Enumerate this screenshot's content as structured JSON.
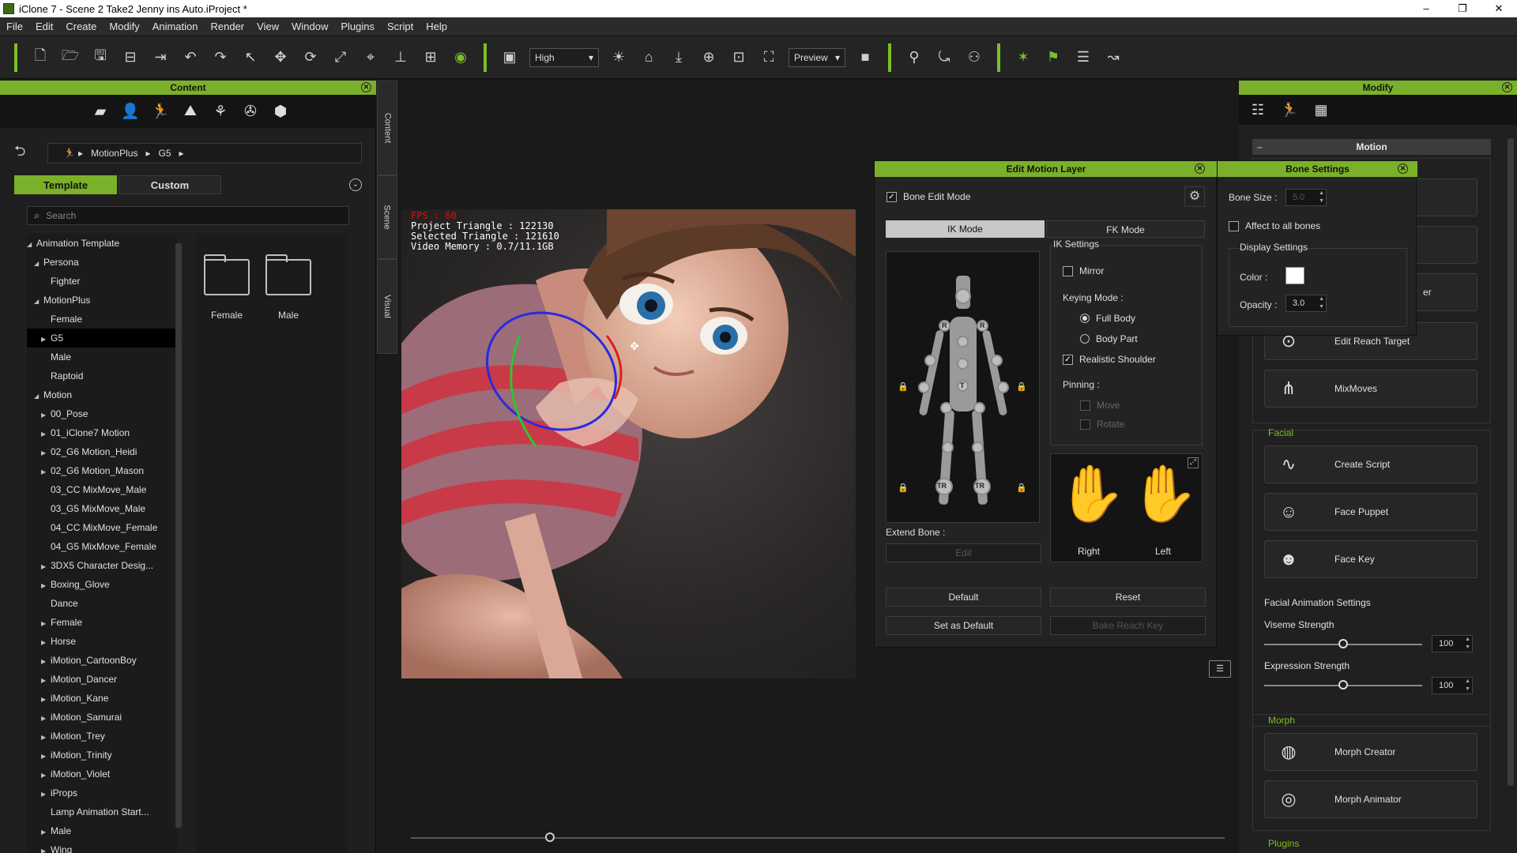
{
  "window": {
    "title": "iClone 7 - Scene 2 Take2 Jenny ins Auto.iProject *"
  },
  "menu": [
    "File",
    "Edit",
    "Create",
    "Modify",
    "Animation",
    "Render",
    "View",
    "Window",
    "Plugins",
    "Script",
    "Help"
  ],
  "toolbar": {
    "quality": "High",
    "preview": "Preview"
  },
  "content": {
    "title": "Content",
    "breadcrumb": [
      "MotionPlus",
      "G5"
    ],
    "tabs": [
      "Template",
      "Custom"
    ],
    "search_placeholder": "Search",
    "tree": [
      {
        "label": "Animation Template",
        "depth": 0,
        "exp": "open"
      },
      {
        "label": "Persona",
        "depth": 1,
        "exp": "open"
      },
      {
        "label": "Fighter",
        "depth": 2,
        "exp": ""
      },
      {
        "label": "MotionPlus",
        "depth": 1,
        "exp": "open"
      },
      {
        "label": "Female",
        "depth": 2,
        "exp": ""
      },
      {
        "label": "G5",
        "depth": 2,
        "exp": "closed",
        "selected": true
      },
      {
        "label": "Male",
        "depth": 2,
        "exp": ""
      },
      {
        "label": "Raptoid",
        "depth": 2,
        "exp": ""
      },
      {
        "label": "Motion",
        "depth": 1,
        "exp": "open"
      },
      {
        "label": "00_Pose",
        "depth": 2,
        "exp": "closed"
      },
      {
        "label": "01_iClone7 Motion",
        "depth": 2,
        "exp": "closed"
      },
      {
        "label": "02_G6 Motion_Heidi",
        "depth": 2,
        "exp": "closed"
      },
      {
        "label": "02_G6 Motion_Mason",
        "depth": 2,
        "exp": "closed"
      },
      {
        "label": "03_CC MixMove_Male",
        "depth": 2,
        "exp": ""
      },
      {
        "label": "03_G5 MixMove_Male",
        "depth": 2,
        "exp": ""
      },
      {
        "label": "04_CC MixMove_Female",
        "depth": 2,
        "exp": ""
      },
      {
        "label": "04_G5 MixMove_Female",
        "depth": 2,
        "exp": ""
      },
      {
        "label": "3DX5 Character Desig...",
        "depth": 2,
        "exp": "closed"
      },
      {
        "label": "Boxing_Glove",
        "depth": 2,
        "exp": "closed"
      },
      {
        "label": "Dance",
        "depth": 2,
        "exp": ""
      },
      {
        "label": "Female",
        "depth": 2,
        "exp": "closed"
      },
      {
        "label": "Horse",
        "depth": 2,
        "exp": "closed"
      },
      {
        "label": "iMotion_CartoonBoy",
        "depth": 2,
        "exp": "closed"
      },
      {
        "label": "iMotion_Dancer",
        "depth": 2,
        "exp": "closed"
      },
      {
        "label": "iMotion_Kane",
        "depth": 2,
        "exp": "closed"
      },
      {
        "label": "iMotion_Samurai",
        "depth": 2,
        "exp": "closed"
      },
      {
        "label": "iMotion_Trey",
        "depth": 2,
        "exp": "closed"
      },
      {
        "label": "iMotion_Trinity",
        "depth": 2,
        "exp": "closed"
      },
      {
        "label": "iMotion_Violet",
        "depth": 2,
        "exp": "closed"
      },
      {
        "label": "iProps",
        "depth": 2,
        "exp": "closed"
      },
      {
        "label": "Lamp Animation Start...",
        "depth": 2,
        "exp": ""
      },
      {
        "label": "Male",
        "depth": 2,
        "exp": "closed"
      },
      {
        "label": "Wing",
        "depth": 2,
        "exp": "closed"
      }
    ],
    "folders": [
      "Female",
      "Male"
    ]
  },
  "sidetabs": [
    "Content",
    "Scene",
    "Visual"
  ],
  "viewport": {
    "fps": "FPS : 60",
    "project_triangle": "Project Triangle : 122130",
    "selected_triangle": "Selected Triangle : 121610",
    "video_memory": "Video Memory : 0.7/11.1GB"
  },
  "edit_motion_layer": {
    "title": "Edit Motion Layer",
    "bone_edit_mode": "Bone Edit Mode",
    "ik_mode": "IK Mode",
    "fk_mode": "FK Mode",
    "ik_settings": "IK Settings",
    "mirror": "Mirror",
    "keying_mode": "Keying Mode :",
    "full_body": "Full Body",
    "body_part": "Body Part",
    "realistic_shoulder": "Realistic Shoulder",
    "pinning": "Pinning :",
    "move": "Move",
    "rotate": "Rotate",
    "extend_bone": "Extend Bone :",
    "edit": "Edit",
    "right": "Right",
    "left": "Left",
    "default": "Default",
    "reset": "Reset",
    "set_as_default": "Set as Default",
    "bake_reach_key": "Bake Reach Key",
    "joint_labels": {
      "r": "R",
      "t": "T",
      "tr": "TR"
    }
  },
  "bone_settings": {
    "title": "Bone Settings",
    "bone_size_label": "Bone Size :",
    "bone_size": "5.0",
    "affect_all": "Affect to all bones",
    "display_settings": "Display Settings",
    "color_label": "Color :",
    "opacity_label": "Opacity :",
    "opacity": "3.0",
    "color": "#ffffff"
  },
  "modify": {
    "title": "Modify",
    "motion_header": "Motion",
    "partial_label": "er",
    "edit_reach_target": "Edit Reach Target",
    "mixmoves": "MixMoves",
    "facial": "Facial",
    "create_script": "Create Script",
    "face_puppet": "Face Puppet",
    "face_key": "Face Key",
    "facial_anim_settings": "Facial Animation Settings",
    "viseme_strength": "Viseme Strength",
    "viseme_value": "100",
    "expression_strength": "Expression Strength",
    "expression_value": "100",
    "morph": "Morph",
    "morph_creator": "Morph Creator",
    "morph_animator": "Morph Animator",
    "plugins": "Plugins"
  },
  "colors": {
    "accent": "#7bb02a"
  }
}
